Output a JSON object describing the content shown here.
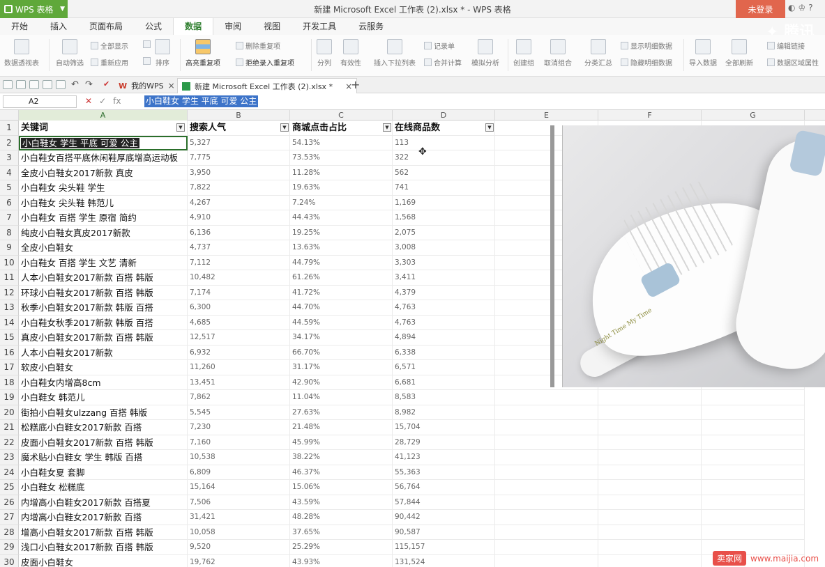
{
  "app_menu": {
    "label": "WPS 表格"
  },
  "window_title": "新建 Microsoft Excel 工作表 (2).xlsx * - WPS 表格",
  "login_label": "未登录",
  "tabs": [
    "开始",
    "插入",
    "页面布局",
    "公式",
    "数据",
    "审阅",
    "视图",
    "开发工具",
    "云服务"
  ],
  "active_tab": "数据",
  "ribbon": {
    "pivot": "数据透视表",
    "autofilter": "自动筛选",
    "show_all": "全部显示",
    "reapply": "重新应用",
    "sort": "排序",
    "highlight_dup": "高亮重复项",
    "delete_dup": "删除重复项",
    "reject_dup": "拒绝录入重复项",
    "split": "分列",
    "validity": "有效性",
    "insert_dropdown": "插入下拉列表",
    "record_form": "记录单",
    "consolidate": "合并计算",
    "what_if": "模拟分析",
    "create_group": "创建组",
    "ungroup": "取消组合",
    "subtotal": "分类汇总",
    "show_detail": "显示明细数据",
    "hide_detail": "隐藏明细数据",
    "import": "导入数据",
    "refresh_all": "全部刷新",
    "edit_link": "编辑链接",
    "range_props": "数据区域属性"
  },
  "doc_tabs": [
    {
      "label": "我的WPS"
    },
    {
      "label": "新建 Microsoft Excel 工作表 (2).xlsx *"
    }
  ],
  "formula_bar": {
    "cell_ref": "A2",
    "content": "小白鞋女 学生 平底 可爱 公主"
  },
  "columns": [
    "A",
    "B",
    "C",
    "D",
    "E",
    "F",
    "G"
  ],
  "headers": {
    "A": "关键词",
    "B": "搜索人气",
    "C": "商城点击占比",
    "D": "在线商品数"
  },
  "rows": [
    {
      "n": "2",
      "kw": "小白鞋女 学生 平底 可爱 公主",
      "pop": "5,327",
      "click": "54.13%",
      "items": "113"
    },
    {
      "n": "3",
      "kw": "小白鞋女百搭平底休闲鞋厚底增高运动板",
      "pop": "7,775",
      "click": "73.53%",
      "items": "322"
    },
    {
      "n": "4",
      "kw": "全皮小白鞋女2017新款 真皮",
      "pop": "3,950",
      "click": "11.28%",
      "items": "562"
    },
    {
      "n": "5",
      "kw": "小白鞋女 尖头鞋 学生",
      "pop": "7,822",
      "click": "19.63%",
      "items": "741"
    },
    {
      "n": "6",
      "kw": "小白鞋女 尖头鞋 韩范儿",
      "pop": "4,267",
      "click": "7.24%",
      "items": "1,169"
    },
    {
      "n": "7",
      "kw": "小白鞋女 百搭 学生 原宿 简约",
      "pop": "4,910",
      "click": "44.43%",
      "items": "1,568"
    },
    {
      "n": "8",
      "kw": "纯皮小白鞋女真皮2017新款",
      "pop": "6,136",
      "click": "19.25%",
      "items": "2,075"
    },
    {
      "n": "9",
      "kw": "全皮小白鞋女",
      "pop": "4,737",
      "click": "13.63%",
      "items": "3,008"
    },
    {
      "n": "10",
      "kw": "小白鞋女 百搭 学生 文艺 清新",
      "pop": "7,112",
      "click": "44.79%",
      "items": "3,303"
    },
    {
      "n": "11",
      "kw": "人本小白鞋女2017新款 百搭 韩版",
      "pop": "10,482",
      "click": "61.26%",
      "items": "3,411"
    },
    {
      "n": "12",
      "kw": "环球小白鞋女2017新款 百搭 韩版",
      "pop": "7,174",
      "click": "41.72%",
      "items": "4,379"
    },
    {
      "n": "13",
      "kw": "秋季小白鞋女2017新款 韩版 百搭",
      "pop": "6,300",
      "click": "44.70%",
      "items": "4,763"
    },
    {
      "n": "14",
      "kw": "小白鞋女秋季2017新款 韩版 百搭",
      "pop": "4,685",
      "click": "44.59%",
      "items": "4,763"
    },
    {
      "n": "15",
      "kw": "真皮小白鞋女2017新款 百搭 韩版",
      "pop": "12,517",
      "click": "34.17%",
      "items": "4,894"
    },
    {
      "n": "16",
      "kw": "人本小白鞋女2017新款",
      "pop": "6,932",
      "click": "66.70%",
      "items": "6,338"
    },
    {
      "n": "17",
      "kw": "软皮小白鞋女",
      "pop": "11,260",
      "click": "31.17%",
      "items": "6,571"
    },
    {
      "n": "18",
      "kw": "小白鞋女内增高8cm",
      "pop": "13,451",
      "click": "42.90%",
      "items": "6,681"
    },
    {
      "n": "19",
      "kw": "小白鞋女 韩范儿",
      "pop": "7,862",
      "click": "11.04%",
      "items": "8,583"
    },
    {
      "n": "20",
      "kw": "街拍小白鞋女ulzzang 百搭 韩版",
      "pop": "5,545",
      "click": "27.63%",
      "items": "8,982"
    },
    {
      "n": "21",
      "kw": "松糕底小白鞋女2017新款 百搭",
      "pop": "7,230",
      "click": "21.48%",
      "items": "15,704"
    },
    {
      "n": "22",
      "kw": "皮面小白鞋女2017新款 百搭 韩版",
      "pop": "7,160",
      "click": "45.99%",
      "items": "28,729"
    },
    {
      "n": "23",
      "kw": "魔术贴小白鞋女 学生 韩版 百搭",
      "pop": "10,538",
      "click": "38.22%",
      "items": "41,123"
    },
    {
      "n": "24",
      "kw": "小白鞋女夏 套脚",
      "pop": "6,809",
      "click": "46.37%",
      "items": "55,363"
    },
    {
      "n": "25",
      "kw": "小白鞋女 松糕底",
      "pop": "15,164",
      "click": "15.06%",
      "items": "56,764"
    },
    {
      "n": "26",
      "kw": "内增高小白鞋女2017新款 百搭夏",
      "pop": "7,506",
      "click": "43.59%",
      "items": "57,844"
    },
    {
      "n": "27",
      "kw": "内增高小白鞋女2017新款 百搭",
      "pop": "31,421",
      "click": "48.28%",
      "items": "90,442"
    },
    {
      "n": "28",
      "kw": "增高小白鞋女2017新款 百搭 韩版",
      "pop": "10,058",
      "click": "37.65%",
      "items": "90,587"
    },
    {
      "n": "29",
      "kw": "浅口小白鞋女2017新款 百搭 韩版",
      "pop": "9,520",
      "click": "25.29%",
      "items": "115,157"
    },
    {
      "n": "30",
      "kw": "皮面小白鞋女",
      "pop": "19,762",
      "click": "43.93%",
      "items": "131,524"
    }
  ],
  "photo": {
    "text": "Night Time My Time"
  },
  "watermark": {
    "badge": "卖家网",
    "url": "www.maijia.com"
  },
  "colors": {
    "accent": "#5fa83a",
    "login": "#e1664d",
    "selection": "#3d74c9"
  }
}
